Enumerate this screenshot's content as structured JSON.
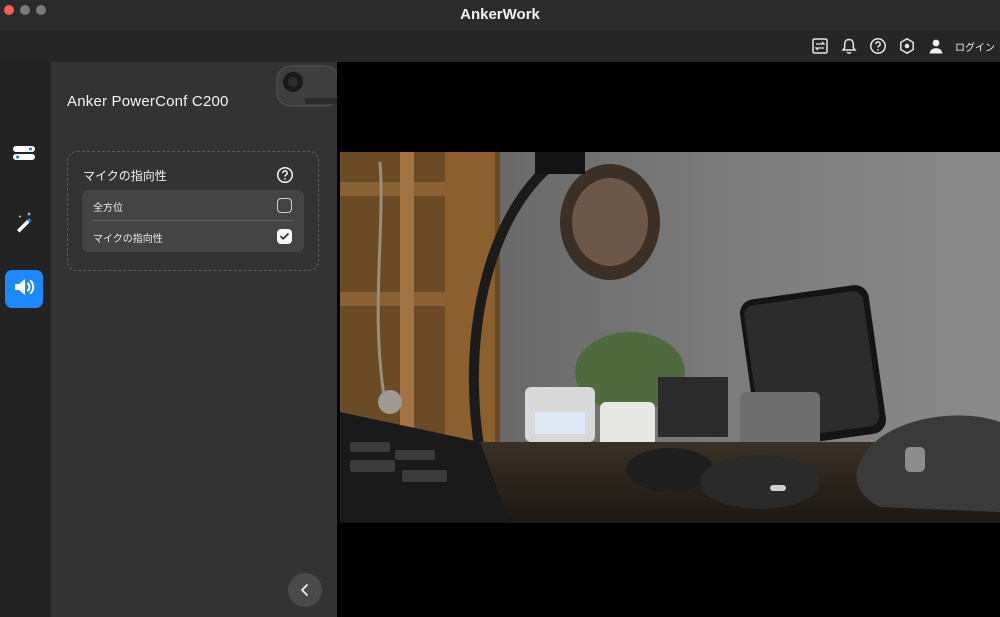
{
  "window": {
    "title": "AnkerWork"
  },
  "toolbar": {
    "icons": [
      "display-switch-icon",
      "bell-icon",
      "help-circle-icon",
      "settings-hexagon-icon",
      "user-icon"
    ],
    "login_label": "ログイン"
  },
  "nav": {
    "items": [
      {
        "icon": "camera-settings-icon",
        "active": false
      },
      {
        "icon": "magic-wand-icon",
        "active": false
      },
      {
        "icon": "speaker-icon",
        "active": true
      }
    ],
    "accent_color": "#1e88ff"
  },
  "panel": {
    "device_name": "Anker PowerConf C200",
    "mic_section": {
      "title": "マイクの指向性",
      "options": [
        {
          "label": "全方位",
          "checked": false
        },
        {
          "label": "マイクの指向性",
          "checked": true
        }
      ]
    }
  },
  "preview": {
    "content": "camera-feed"
  }
}
